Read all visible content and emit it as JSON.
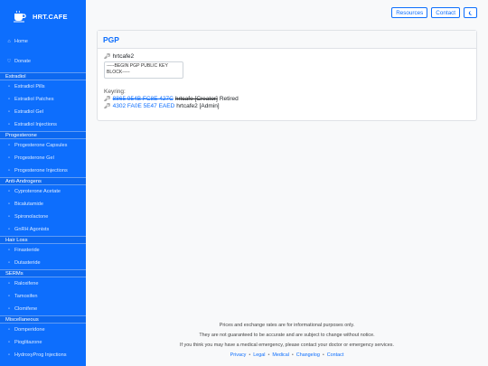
{
  "brand": {
    "name": "HRT.CAFE"
  },
  "sidebar": {
    "top": [
      {
        "label": "Home",
        "icon": "home-icon"
      },
      {
        "label": "Donate",
        "icon": "donate-icon"
      }
    ],
    "sections": [
      {
        "title": "Estradiol",
        "items": [
          "Estradiol Pills",
          "Estradiol Patches",
          "Estradiol Gel",
          "Estradiol Injections"
        ]
      },
      {
        "title": "Progesterone",
        "items": [
          "Progesterone Capsules",
          "Progesterone Gel",
          "Progesterone Injections"
        ]
      },
      {
        "title": "Anti-Androgens",
        "items": [
          "Cyproterone Acetate",
          "Bicalutamide",
          "Spironolactone",
          "GnRH Agonists"
        ]
      },
      {
        "title": "Hair Loss",
        "items": [
          "Finasteride",
          "Dutasteride"
        ]
      },
      {
        "title": "SERMs",
        "items": [
          "Raloxifene",
          "Tamoxifen",
          "Clomifene"
        ]
      },
      {
        "title": "Miscellaneous",
        "items": [
          "Domperidone",
          "Pioglitazone",
          "HydroxyProg Injections"
        ]
      }
    ]
  },
  "topbar": {
    "resources": "Resources",
    "contact": "Contact",
    "theme_icon": "moon-icon"
  },
  "card": {
    "title": "PGP",
    "key_name": "hrtcafe2",
    "textarea_value": "-----BEGIN PGP PUBLIC KEY BLOCK-----",
    "keyring_label": "Keyring:",
    "keys": [
      {
        "fingerprint": "8865 954B FC8E 427C",
        "name": "hrtcafe [Creator]",
        "status": "Retired",
        "retired": true
      },
      {
        "fingerprint": "4302 FA0E 5E47 EAED",
        "name": "hrtcafe2 [Admin]",
        "status": "",
        "retired": false
      }
    ]
  },
  "footer": {
    "line1": "Prices and exchange rates are for informational purposes only.",
    "line2": "They are not guaranteed to be accurate and are subject to change without notice.",
    "line3": "If you think you may have a medical emergency, please contact your doctor or emergency services.",
    "links": [
      "Privacy",
      "Legal",
      "Medical",
      "Changelog",
      "Contact"
    ]
  }
}
